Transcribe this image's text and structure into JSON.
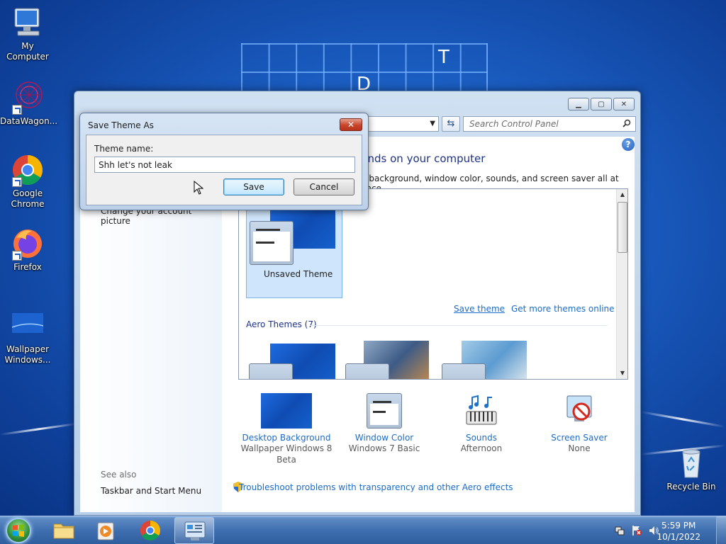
{
  "desktop": {
    "wallpaper_letters": [
      "T",
      "D"
    ],
    "icons": [
      {
        "label": "My Computer"
      },
      {
        "label": "DataWagon..."
      },
      {
        "label": "Google Chrome"
      },
      {
        "label": "Firefox"
      },
      {
        "label": "Wallpaper Windows..."
      },
      {
        "label": "Recycle Bin"
      }
    ]
  },
  "control_panel": {
    "search_placeholder": "Search Control Panel",
    "heading": "unds on your computer",
    "description": "p background, window color, sounds, and screen saver all at once.",
    "left_link": "Change your account picture",
    "see_also": "See also",
    "see_also_link": "Taskbar and Start Menu",
    "my_theme": {
      "label": "Unsaved Theme"
    },
    "save_theme_link": "Save theme",
    "get_more_link": "Get more themes online",
    "aero_section": "Aero Themes (7)",
    "bottom_items": [
      {
        "link": "Desktop Background",
        "sub": "Wallpaper Windows 8 Beta"
      },
      {
        "link": "Window Color",
        "sub": "Windows 7 Basic"
      },
      {
        "link": "Sounds",
        "sub": "Afternoon"
      },
      {
        "link": "Screen Saver",
        "sub": "None"
      }
    ],
    "troubleshoot_link": "Troubleshoot problems with transparency and other Aero effects"
  },
  "dialog": {
    "title": "Save Theme As",
    "field_label": "Theme name:",
    "field_value": "Shh let's not leak",
    "save_label": "Save",
    "cancel_label": "Cancel",
    "close_glyph": "✕"
  },
  "taskbar": {
    "time": "5:59 PM",
    "date": "10/1/2022"
  }
}
